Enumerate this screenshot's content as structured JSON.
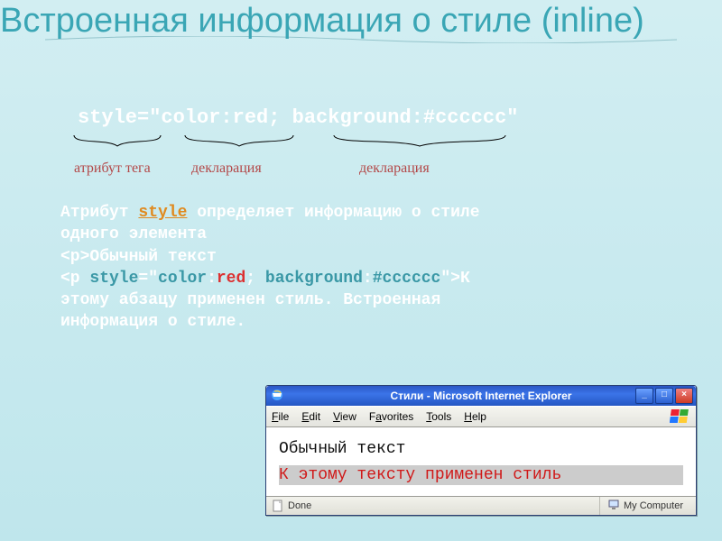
{
  "title": "Встроенная информация о стиле (inline)",
  "attr_line": {
    "style_attr": "style",
    "eq": "=",
    "q": "\"",
    "part1": "color:red;",
    "space": "  ",
    "part2": "background:#cccccc"
  },
  "brace_labels": {
    "a": "атрибут тега",
    "b": "декларация",
    "c": "декларация"
  },
  "body": {
    "line1a": "Атрибут ",
    "line1_style": "style",
    "line1b": " определяет информацию о стиле",
    "line2": "одного элемента",
    "line3": "<p>Обычный текст",
    "line4_pre": "<p ",
    "line4_style": "style",
    "line4_eq": "=",
    "line4_q": "\"",
    "line4_colorkey": "color",
    "line4_colon": ":",
    "line4_red": "red",
    "line4_semi": ";  ",
    "line4_bgkey": "background",
    "line4_colon2": ":",
    "line4_bgval": "#cccccc",
    "line4_close": "\">К",
    "line5": "этому абзацу применен стиль. Встроенная",
    "line6": "информация о стиле."
  },
  "ie": {
    "title": "Стили - Microsoft Internet Explorer",
    "menu": {
      "file": "File",
      "edit": "Edit",
      "view": "View",
      "favorites": "Favorites",
      "tools": "Tools",
      "help": "Help"
    },
    "controls": {
      "min": "_",
      "max": "□",
      "close": "×"
    },
    "content": {
      "p1": "Обычный текст",
      "p2": "К этому тексту применен стиль"
    },
    "status": {
      "done": "Done",
      "zone": "My Computer"
    }
  }
}
